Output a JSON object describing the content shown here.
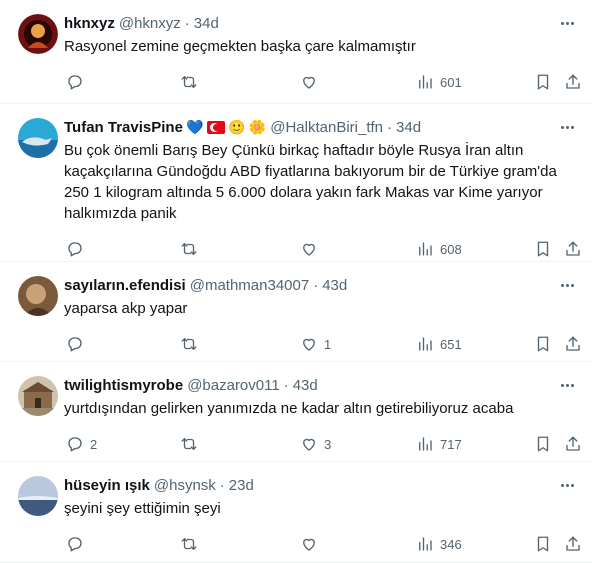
{
  "tweets": [
    {
      "name": "hknxyz",
      "handle": "@hknxyz",
      "time": "34d",
      "text": "Rasyonel zemine geçmekten başka çare kalmamıştır",
      "replies": "",
      "retweets": "",
      "likes": "",
      "views": "601"
    },
    {
      "name": "Tufan TravisPine",
      "name_emojis": [
        "💙",
        "🙂",
        "🌼"
      ],
      "handle": "@HalktanBiri_tfn",
      "time": "34d",
      "text": "Bu çok önemli Barış Bey Çünkü birkaç haftadır böyle Rusya İran altın kaçakçılarına Gündoğdu ABD fiyatlarına bakıyorum bir de Türkiye gram'da 250 1 kilogram altında 5 6.000 dolara yakın fark Makas var Kime yarıyor halkımızda panik",
      "replies": "",
      "retweets": "",
      "likes": "",
      "views": "608"
    },
    {
      "name": "sayıların.efendisi",
      "handle": "@mathman34007",
      "time": "43d",
      "text": "yaparsa akp yapar",
      "replies": "",
      "retweets": "",
      "likes": "1",
      "views": "651"
    },
    {
      "name": "twilightismyrobe",
      "handle": "@bazarov011",
      "time": "43d",
      "text": "yurtdışından gelirken yanımızda ne kadar altın getirebiliyoruz acaba",
      "replies": "2",
      "retweets": "",
      "likes": "3",
      "views": "717"
    },
    {
      "name": "hüseyin ışık",
      "handle": "@hsynsk",
      "time": "23d",
      "text": "şeyini şey ettiğimin şeyi",
      "replies": "",
      "retweets": "",
      "likes": "",
      "views": "346"
    }
  ],
  "separator": "·",
  "icons": {
    "reply": "reply-icon",
    "retweet": "retweet-icon",
    "like": "like-icon",
    "views": "views-icon",
    "bookmark": "bookmark-icon",
    "share": "share-icon",
    "more": "more-icon"
  }
}
